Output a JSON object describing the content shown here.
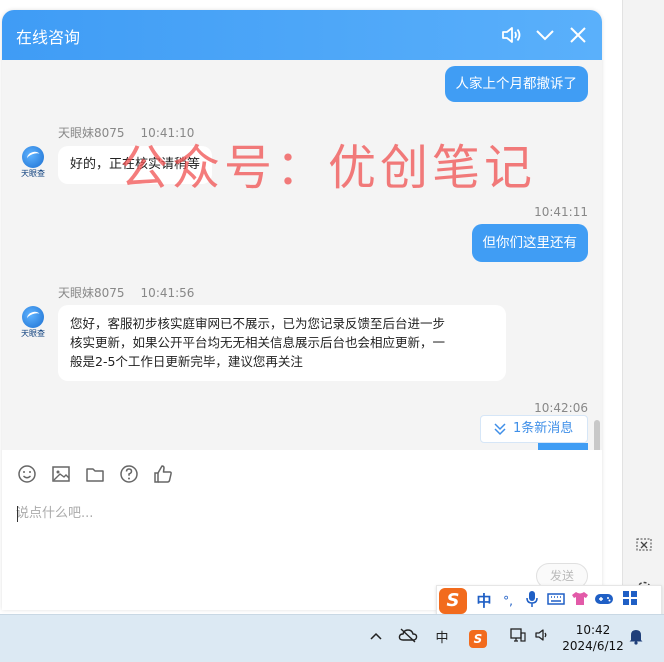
{
  "header": {
    "title": "在线咨询"
  },
  "messages": {
    "m1": {
      "text": "人家上个月都撤诉了"
    },
    "m2": {
      "sender": "天眼妹8075",
      "time": "10:41:10",
      "text": "好的，正在核实请稍等"
    },
    "m3": {
      "time": "10:41:11",
      "text": "但你们这里还有"
    },
    "m4": {
      "sender": "天眼妹8075",
      "time": "10:41:56",
      "line1": "您好，客服初步核实庭审网已不展示，已为您记录反馈至后台进一步",
      "line2": "核实更新，如果公开平台均无无相关信息展示后台也会相应更新，一",
      "line3": "般是2-5个工作日更新完毕，建议您再关注"
    },
    "m5": {
      "time": "10:42:06"
    }
  },
  "avatar_label": "天眼查",
  "watermark": "公众号：优创笔记",
  "new_message": {
    "label": "1条新消息"
  },
  "input": {
    "placeholder": "说点什么吧..."
  },
  "send_button": "发送",
  "ime": {
    "mode": "中",
    "punct": "°,"
  },
  "taskbar": {
    "ime_indicator": "中",
    "time": "10:42",
    "date": "2024/6/12"
  },
  "colors": {
    "header": "#409df4",
    "bubble_right": "#409df4",
    "watermark": "#f05050"
  }
}
